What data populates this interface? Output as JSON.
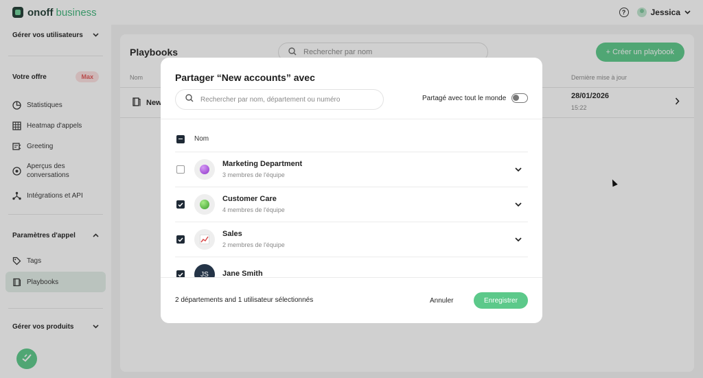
{
  "app": {
    "brand_name": "onoff",
    "brand_sub": "business",
    "user_name": "Jessica",
    "help_glyph": "?"
  },
  "sidebar": {
    "manage_users": "Gérer vos utilisateurs",
    "offer_label": "Votre offre",
    "offer_badge": "Max",
    "items": [
      {
        "label": "Statistiques",
        "icon": "chart-pie-icon"
      },
      {
        "label": "Heatmap d'appels",
        "icon": "grid-icon"
      },
      {
        "label": "Greeting",
        "icon": "greeting-icon"
      },
      {
        "label": "Aperçus des conversations",
        "icon": "target-icon"
      },
      {
        "label": "Intégrations et API",
        "icon": "integrations-icon"
      }
    ],
    "call_settings": "Paramètres d'appel",
    "call_items": [
      {
        "label": "Tags",
        "icon": "tag-icon"
      },
      {
        "label": "Playbooks",
        "icon": "book-icon"
      }
    ],
    "manage_products": "Gérer vos produits"
  },
  "main": {
    "title": "Playbooks",
    "search_placeholder": "Rechercher par nom",
    "create_button": "+ Créer un playbook",
    "col_name": "Nom",
    "col_updated": "Dernière mise à jour",
    "row_name": "New",
    "row_date": "28/01/2026",
    "row_time": "15:22"
  },
  "modal": {
    "title": "Partager “New accounts” avec",
    "search_placeholder": "Rechercher par nom, département ou numéro",
    "share_all_label": "Partagé avec tout le monde",
    "share_all_on": false,
    "list_header": "Nom",
    "entries": [
      {
        "name": "Marketing Department",
        "sub": "3 membres de l'équipe",
        "checked": false,
        "icon": "purple-circle",
        "color": "#a04ed6"
      },
      {
        "name": "Customer Care",
        "sub": "4 membres de l'équipe",
        "checked": true,
        "icon": "green-circle",
        "color": "#4cb83c"
      },
      {
        "name": "Sales",
        "sub": "2 membres de l'équipe",
        "checked": true,
        "icon": "chart-up-emoji",
        "color": "#d94b4b"
      },
      {
        "name": "Jane Smith",
        "sub": "",
        "checked": true,
        "initials": "JS"
      }
    ],
    "footer_status": "2 départements and 1 utilisateur sélectionnés",
    "cancel_label": "Annuler",
    "save_label": "Enregistrer"
  },
  "colors": {
    "accent_green": "#5cc98a",
    "dark_navy": "#1f2a36",
    "badge_red": "#e05555"
  }
}
